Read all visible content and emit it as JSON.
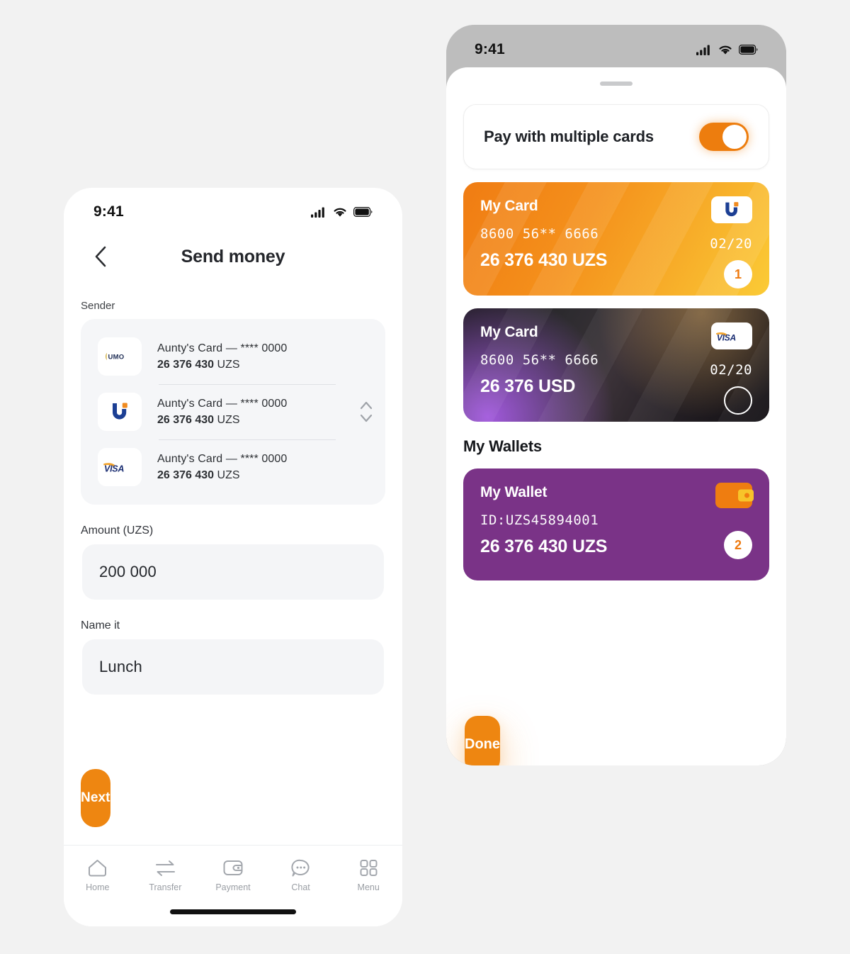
{
  "colors": {
    "accent_orange": "#ee8611",
    "toggle_orange": "#ed7d0e",
    "wallet_purple": "#7a3387",
    "page_background": "#f2f2f2",
    "field_grey": "#f4f5f7",
    "statusbar_grey": "#bdbdbd"
  },
  "left_phone": {
    "status_bar": {
      "time": "9:41",
      "icons": [
        "cellular-signal-icon",
        "wifi-icon",
        "battery-icon"
      ]
    },
    "nav": {
      "back_icon": "chevron-left-icon",
      "title": "Send money"
    },
    "sender": {
      "label": "Sender",
      "stepper_icon": "chevron-up-down-icon",
      "rows": [
        {
          "brand": "HUMO",
          "brand_icon": "humo-logo-icon",
          "name": "Aunty's Card",
          "dash": "—",
          "mask": "**** 0000",
          "balance": "26 376 430",
          "currency": "UZS"
        },
        {
          "brand": "UZCARD",
          "brand_icon": "uzcard-logo-icon",
          "name": "Aunty's Card",
          "dash": "—",
          "mask": "**** 0000",
          "balance": "26 376 430",
          "currency": "UZS"
        },
        {
          "brand": "VISA",
          "brand_icon": "visa-logo-icon",
          "name": "Aunty's Card",
          "dash": "—",
          "mask": "**** 0000",
          "balance": "26 376 430",
          "currency": "UZS"
        }
      ]
    },
    "amount_field": {
      "label": "Amount (UZS)",
      "value": "200 000",
      "placeholder": "0"
    },
    "name_field": {
      "label": "Name it",
      "value": "Lunch",
      "placeholder": "Name it"
    },
    "next_button": {
      "label": "Next"
    },
    "tabbar": [
      {
        "label": "Home",
        "icon": "home-icon"
      },
      {
        "label": "Transfer",
        "icon": "transfer-arrows-icon"
      },
      {
        "label": "Payment",
        "icon": "wallet-icon"
      },
      {
        "label": "Chat",
        "icon": "chat-bubble-icon"
      },
      {
        "label": "Menu",
        "icon": "grid-menu-icon"
      }
    ]
  },
  "right_phone": {
    "status_bar": {
      "time": "9:41",
      "icons": [
        "cellular-signal-icon",
        "wifi-icon",
        "battery-icon"
      ]
    },
    "toggle_row": {
      "label": "Pay with multiple cards",
      "state": "on"
    },
    "cards": [
      {
        "title": "My Card",
        "number": "8600 56** 6666",
        "expiry": "02/20",
        "balance": "26 376 430 UZS",
        "brand_icon": "uzcard-logo-icon",
        "selection": "1",
        "selected": true
      },
      {
        "title": "My Card",
        "number": "8600 56** 6666",
        "expiry": "02/20",
        "balance": "26 376 USD",
        "brand_icon": "visa-logo-icon",
        "selection": "",
        "selected": false
      }
    ],
    "wallets_title": "My Wallets",
    "wallets": [
      {
        "title": "My Wallet",
        "id": "ID:UZS45894001",
        "balance": "26 376 430 UZS",
        "icon": "wallet-icon",
        "selection": "2",
        "selected": true
      }
    ],
    "done_button": {
      "label": "Done"
    }
  }
}
